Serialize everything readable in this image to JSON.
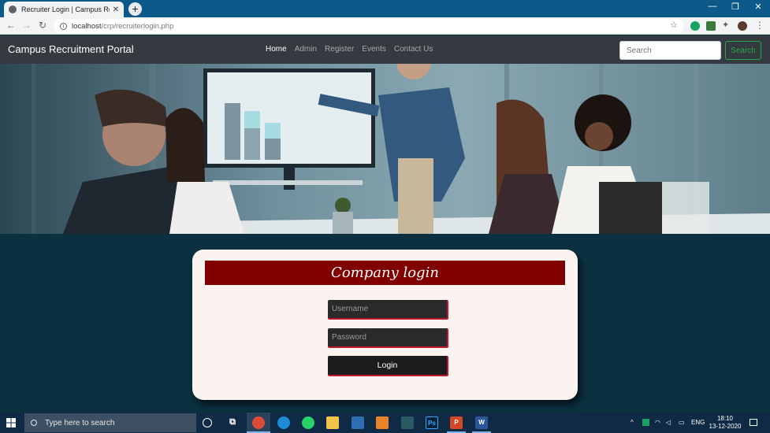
{
  "browser": {
    "tab_title": "Recruiter Login | Campus Recruitm",
    "tab_close": "✕",
    "new_tab": "+",
    "url_host": "localhost",
    "url_path": "/crp/recruiterlogin.php",
    "window_controls": [
      "—",
      "❐",
      "✕"
    ]
  },
  "site": {
    "brand": "Campus Recruitment Portal",
    "nav": [
      {
        "label": "Home",
        "active": true
      },
      {
        "label": "Admin"
      },
      {
        "label": "Register"
      },
      {
        "label": "Events"
      },
      {
        "label": "Contact Us"
      }
    ],
    "search_placeholder": "Search",
    "search_button": "Search"
  },
  "login": {
    "title": "Company login",
    "username_placeholder": "Username",
    "password_placeholder": "Password",
    "submit": "Login"
  },
  "taskbar": {
    "search_text": "Type here to search",
    "language": "ENG",
    "time": "18:10",
    "date": "13-12-2020"
  },
  "colors": {
    "navbar": "#343a40",
    "page_bg": "#0b3040",
    "card_bg": "#fbf3f0",
    "card_header": "#800000",
    "search_accent": "#28a745"
  }
}
